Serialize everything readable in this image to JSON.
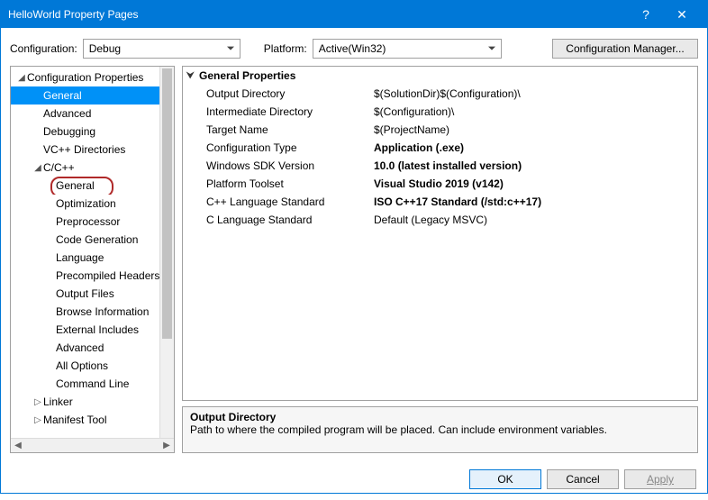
{
  "title": "HelloWorld Property Pages",
  "toprow": {
    "config_label": "Configuration:",
    "config_value": "Debug",
    "platform_label": "Platform:",
    "platform_value": "Active(Win32)",
    "manager_btn": "Configuration Manager..."
  },
  "tree": {
    "root": "Configuration Properties",
    "items_lvl1": [
      "General",
      "Advanced",
      "Debugging",
      "VC++ Directories"
    ],
    "cpp_label": "C/C++",
    "cpp_children": [
      "General",
      "Optimization",
      "Preprocessor",
      "Code Generation",
      "Language",
      "Precompiled Headers",
      "Output Files",
      "Browse Information",
      "External Includes",
      "Advanced",
      "All Options",
      "Command Line"
    ],
    "linker_label": "Linker",
    "manifest_label": "Manifest Tool"
  },
  "props": {
    "header": "General Properties",
    "rows": [
      {
        "name": "Output Directory",
        "value": "$(SolutionDir)$(Configuration)\\",
        "bold": false
      },
      {
        "name": "Intermediate Directory",
        "value": "$(Configuration)\\",
        "bold": false
      },
      {
        "name": "Target Name",
        "value": "$(ProjectName)",
        "bold": false
      },
      {
        "name": "Configuration Type",
        "value": "Application (.exe)",
        "bold": true
      },
      {
        "name": "Windows SDK Version",
        "value": "10.0 (latest installed version)",
        "bold": true
      },
      {
        "name": "Platform Toolset",
        "value": "Visual Studio 2019 (v142)",
        "bold": true
      },
      {
        "name": "C++ Language Standard",
        "value": "ISO C++17 Standard (/std:c++17)",
        "bold": true
      },
      {
        "name": "C Language Standard",
        "value": "Default (Legacy MSVC)",
        "bold": false
      }
    ]
  },
  "help": {
    "title": "Output Directory",
    "text": "Path to where the compiled program will be placed. Can include environment variables."
  },
  "footer": {
    "ok": "OK",
    "cancel": "Cancel",
    "apply": "Apply"
  }
}
